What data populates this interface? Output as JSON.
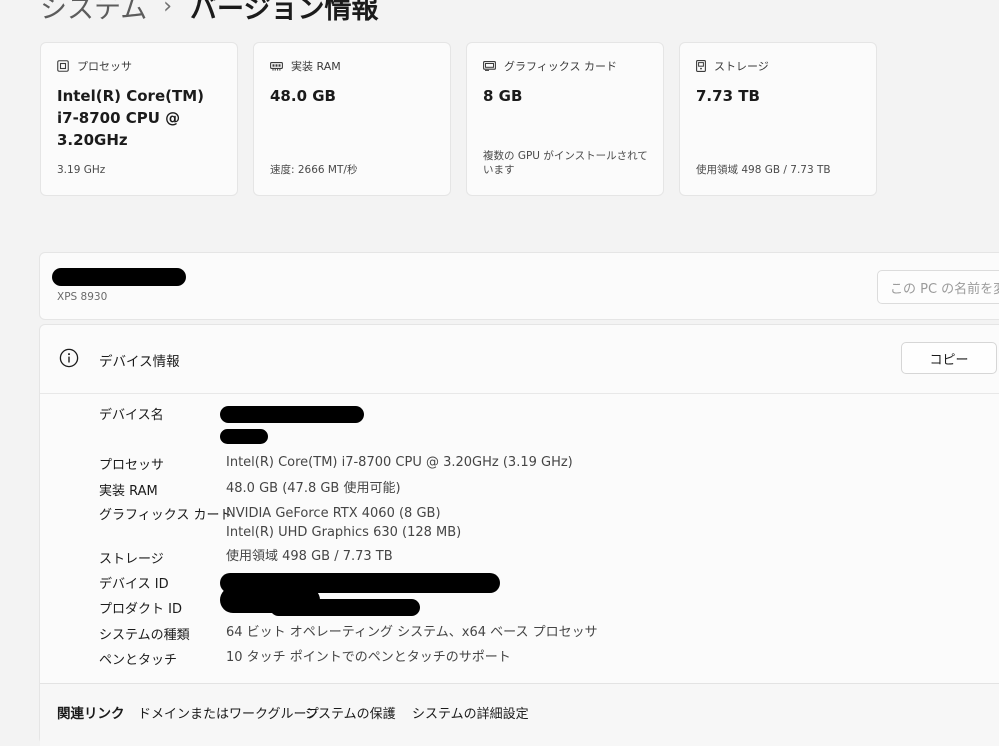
{
  "breadcrumb": {
    "parent": "システム",
    "separator": "›",
    "current": "バージョン情報"
  },
  "cards": {
    "processor": {
      "label": "プロセッサ",
      "value": "Intel(R) Core(TM) i7-8700 CPU @ 3.20GHz",
      "sub": "3.19 GHz",
      "icon": "processor-icon"
    },
    "ram": {
      "label": "実装 RAM",
      "value": "48.0 GB",
      "sub": "速度: 2666 MT/秒",
      "icon": "memory-icon"
    },
    "gpu": {
      "label": "グラフィックス カード",
      "value": "8 GB",
      "sub": "複数の GPU がインストールされています",
      "icon": "gpu-icon"
    },
    "storage": {
      "label": "ストレージ",
      "value": "7.73 TB",
      "sub": "使用領域 498 GB / 7.73 TB",
      "icon": "storage-icon"
    }
  },
  "rename": {
    "model": "XPS 8930",
    "button_label": "この PC の名前を変更"
  },
  "device": {
    "title": "デバイス情報",
    "copy_label": "コピー",
    "labels": {
      "device_name": "デバイス名",
      "processor": "プロセッサ",
      "ram": "実装 RAM",
      "gpu": "グラフィックス カード",
      "storage": "ストレージ",
      "device_id": "デバイス ID",
      "product_id": "プロダクト ID",
      "system_type": "システムの種類",
      "pen_touch": "ペンとタッチ"
    },
    "values": {
      "processor": "Intel(R) Core(TM) i7-8700 CPU @ 3.20GHz (3.19 GHz)",
      "ram": "48.0 GB (47.8 GB 使用可能)",
      "gpu_1": "NVIDIA GeForce RTX 4060 (8 GB)",
      "gpu_2": "Intel(R) UHD Graphics 630 (128 MB)",
      "storage": "使用領域 498 GB / 7.73 TB",
      "system_type": "64 ビット オペレーティング システム、x64 ベース プロセッサ",
      "pen_touch": "10 タッチ ポイントでのペンとタッチのサポート"
    }
  },
  "related": {
    "title": "関連リンク",
    "links": [
      "ドメインまたはワークグループ",
      "システムの保護",
      "システムの詳細設定"
    ]
  },
  "colors": {
    "background": "#f3f3f3",
    "card": "#fbfbfb",
    "border": "#e5e5e5",
    "redaction": "#000000"
  }
}
